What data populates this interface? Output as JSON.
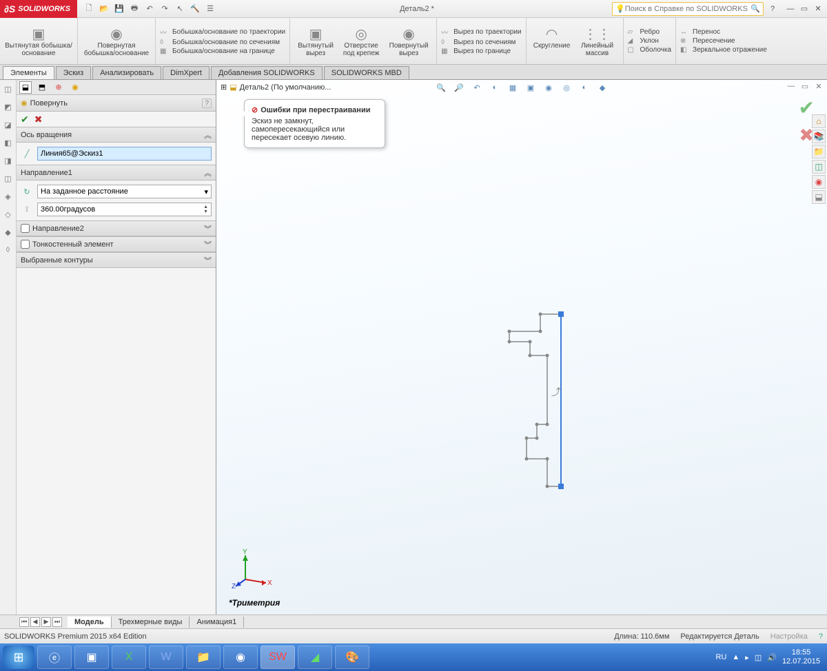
{
  "title_bar": {
    "brand": "SOLIDWORKS",
    "doc_title": "Деталь2 *",
    "search_placeholder": "Поиск в Справке по SOLIDWORKS"
  },
  "ribbon": {
    "extrude": "Вытянутая бобышка/основание",
    "revolve": "Повернутая бобышка/основание",
    "sweep": "Бобышка/основание по траектории",
    "loft": "Бобышка/основание по сечениям",
    "boundary": "Бобышка/основание на границе",
    "cut_extrude": "Вытянутый вырез",
    "hole": "Отверстие под крепеж",
    "cut_revolve": "Повернутый вырез",
    "cut_sweep": "Вырез по траектории",
    "cut_loft": "Вырез по сечениям",
    "cut_boundary": "Вырез по границе",
    "fillet": "Скругление",
    "pattern": "Линейный массив",
    "rib": "Ребро",
    "draft": "Уклон",
    "shell": "Оболочка",
    "move": "Перенос",
    "intersect": "Пересечение",
    "mirror": "Зеркальное отражение"
  },
  "tabs": {
    "t1": "Элементы",
    "t2": "Эскиз",
    "t3": "Анализировать",
    "t4": "DimXpert",
    "t5": "Добавления SOLIDWORKS",
    "t6": "SOLIDWORKS MBD"
  },
  "pm": {
    "feature_title": "Повернуть",
    "sec_axis": "Ось вращения",
    "axis_value": "Линия65@Эскиз1",
    "sec_dir1": "Направление1",
    "dir_mode": "На заданное расстояние",
    "angle": "360.00градусов",
    "sec_dir2": "Направление2",
    "sec_thin": "Тонкостенный элемент",
    "sec_contours": "Выбранные контуры"
  },
  "crumb": {
    "text": "Деталь2  (По умолчанию..."
  },
  "callout": {
    "title": "Ошибки при перестраивании",
    "body": "Эскиз не замкнут, самопересекающийся или пересекает осевую линию."
  },
  "view_label": "Триметрия",
  "model_tabs": {
    "t1": "Модель",
    "t2": "Трехмерные виды",
    "t3": "Анимация1"
  },
  "status": {
    "edition": "SOLIDWORKS Premium 2015 x64 Edition",
    "length": "Длина: 110.6мм",
    "editing": "Редактируется Деталь",
    "custom": "Настройка"
  },
  "taskbar": {
    "lang": "RU",
    "time": "18:55",
    "date": "12.07.2015"
  },
  "triad": {
    "x": "X",
    "y": "Y",
    "z": "Z"
  }
}
